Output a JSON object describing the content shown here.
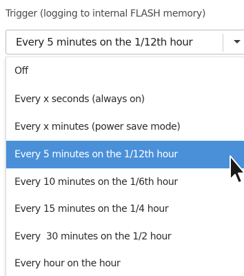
{
  "trigger": {
    "label": "Trigger (logging to internal FLASH memory)",
    "selected_value": "Every 5 minutes on the 1/12th hour",
    "dropdown_icon": "chevron-down-icon",
    "options": [
      {
        "label": "Off"
      },
      {
        "label": "Every x seconds (always on)"
      },
      {
        "label": "Every x minutes (power save mode)"
      },
      {
        "label": "Every 5 minutes on the 1/12th hour",
        "selected": true
      },
      {
        "label": "Every 10 minutes on the 1/6th hour"
      },
      {
        "label": "Every 15 minutes on the 1/4 hour"
      },
      {
        "label": "Every  30 minutes on the 1/2 hour"
      },
      {
        "label": "Every hour on the hour"
      }
    ]
  },
  "colors": {
    "highlight": "#4a90d9",
    "highlight_text": "#ffffff",
    "text": "#2b2b2b"
  }
}
